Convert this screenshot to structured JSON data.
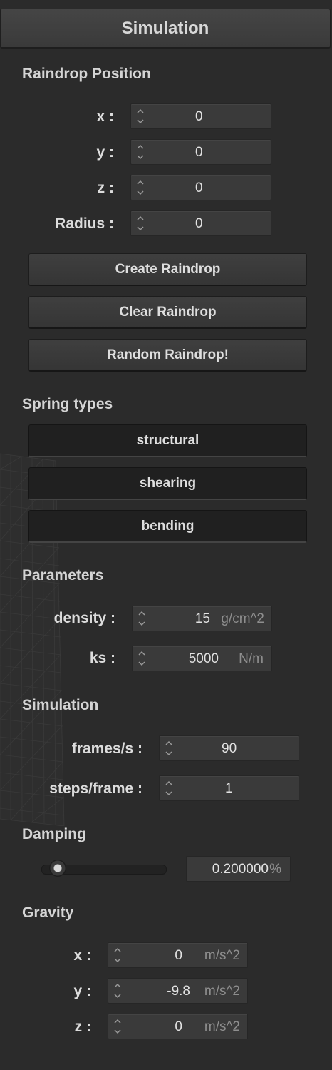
{
  "panel": {
    "title": "Simulation"
  },
  "raindrop_position": {
    "heading": "Raindrop Position",
    "fields": [
      {
        "label": "x :",
        "value": "0"
      },
      {
        "label": "y :",
        "value": "0"
      },
      {
        "label": "z :",
        "value": "0"
      },
      {
        "label": "Radius :",
        "value": "0"
      }
    ],
    "buttons": [
      "Create Raindrop",
      "Clear Raindrop",
      "Random Raindrop!"
    ]
  },
  "spring_types": {
    "heading": "Spring types",
    "buttons": [
      "structural",
      "shearing",
      "bending"
    ]
  },
  "parameters": {
    "heading": "Parameters",
    "density": {
      "label": "density :",
      "value": "15",
      "unit": "g/cm^2"
    },
    "ks": {
      "label": "ks :",
      "value": "5000",
      "unit": "N/m"
    }
  },
  "simulation": {
    "heading": "Simulation",
    "fps": {
      "label": "frames/s :",
      "value": "90"
    },
    "steps": {
      "label": "steps/frame :",
      "value": "1"
    }
  },
  "damping": {
    "heading": "Damping",
    "value": "0.200000",
    "unit": "%",
    "slider_fraction": 0.2
  },
  "gravity": {
    "heading": "Gravity",
    "fields": [
      {
        "label": "x :",
        "value": "0",
        "unit": "m/s^2"
      },
      {
        "label": "y :",
        "value": "-9.8",
        "unit": "m/s^2"
      },
      {
        "label": "z :",
        "value": "0",
        "unit": "m/s^2"
      }
    ]
  }
}
